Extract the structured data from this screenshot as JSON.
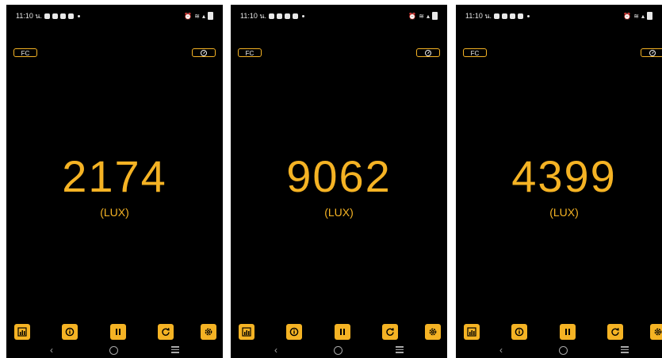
{
  "colors": {
    "accent": "#f5b324",
    "background": "#000000",
    "statusbar_text": "#e8e8e8"
  },
  "screens": [
    {
      "status": {
        "time": "11:10 น."
      },
      "unit_toggle": "FC",
      "reading": "2174",
      "unit": "(LUX)"
    },
    {
      "status": {
        "time": "11:10 น."
      },
      "unit_toggle": "FC",
      "reading": "9062",
      "unit": "(LUX)"
    },
    {
      "status": {
        "time": "11:10 น."
      },
      "unit_toggle": "FC",
      "reading": "4399",
      "unit": "(LUX)"
    }
  ],
  "icons": {
    "toolbar": [
      "chart-icon",
      "info-icon",
      "pause-icon",
      "reset-icon",
      "settings-icon"
    ],
    "navbar": [
      "back-icon",
      "home-icon",
      "recent-apps-icon"
    ]
  }
}
